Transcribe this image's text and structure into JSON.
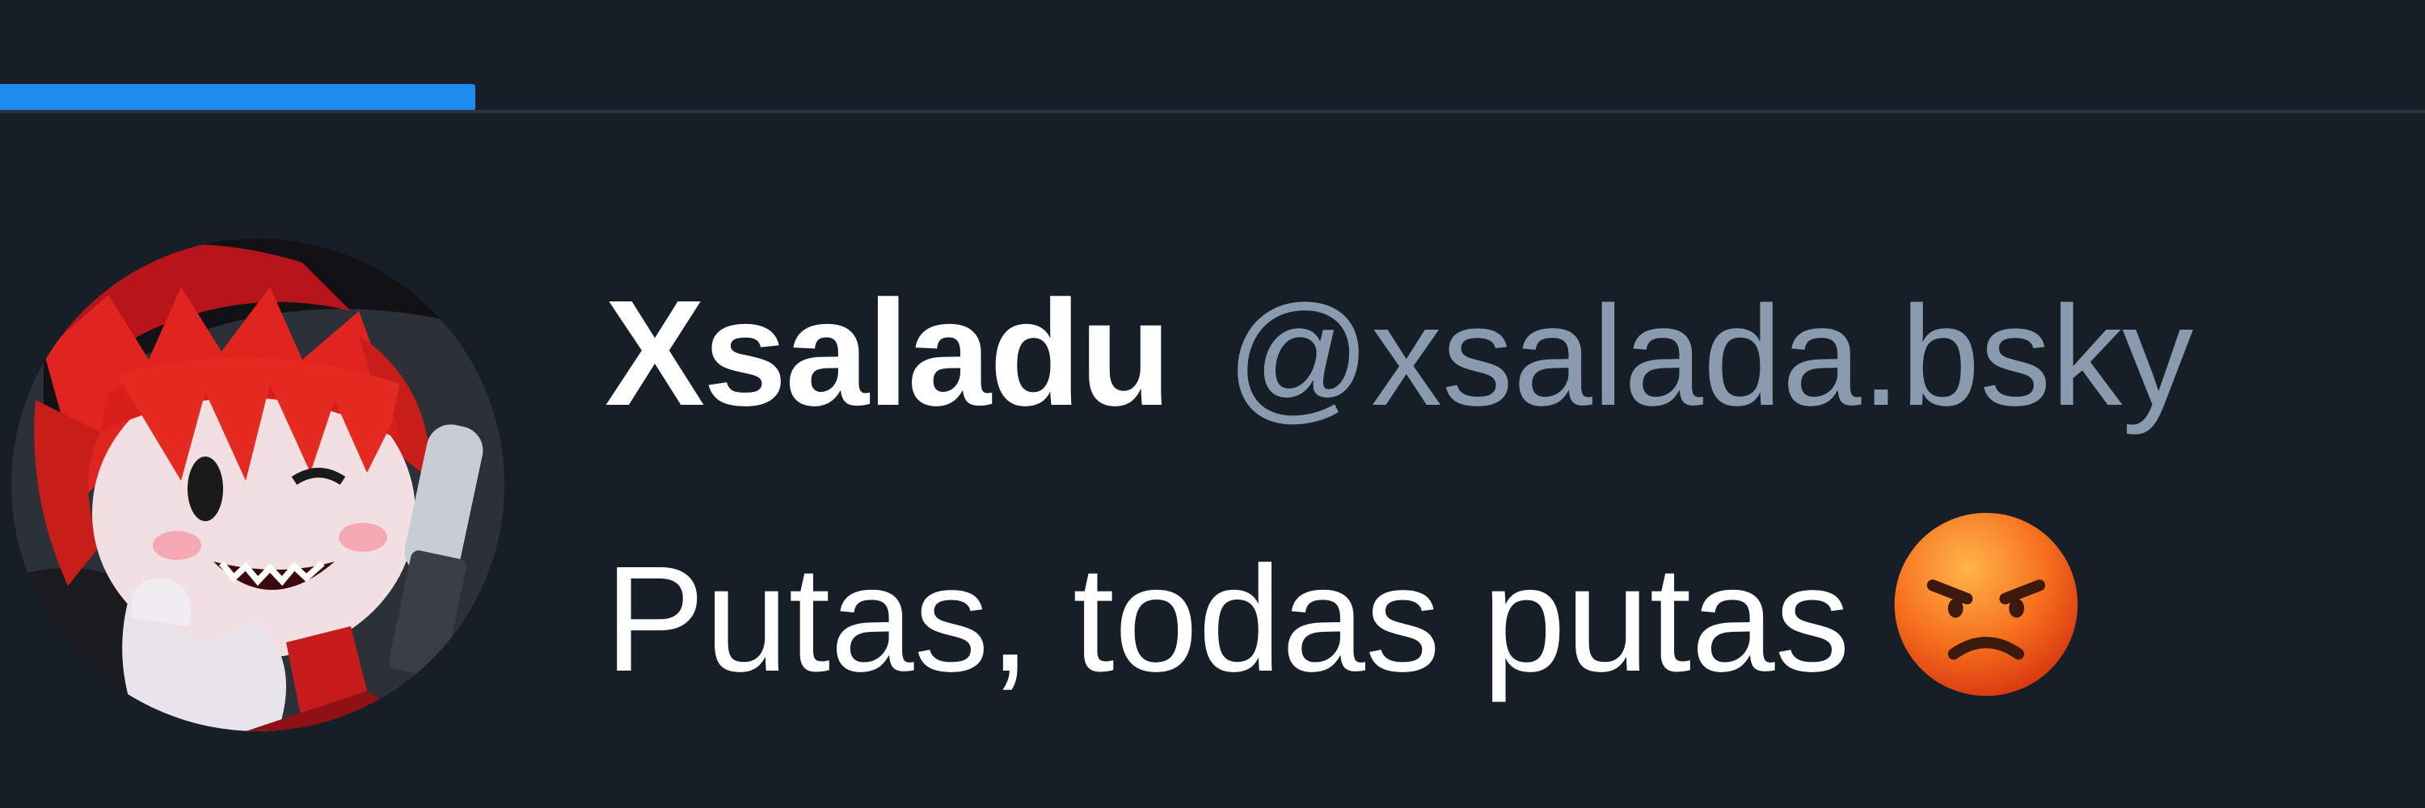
{
  "header": {
    "active_tab_color": "#1d8bf0"
  },
  "post": {
    "author": {
      "display_name": "Xsaladu",
      "handle": "@xsalada.bsky",
      "avatar_icon": "anime-avatar"
    },
    "text": "Putas, todas putas",
    "emoji": {
      "name": "angry-face-emoji",
      "char": "😠"
    }
  },
  "colors": {
    "background": "#161e27",
    "display_name": "#ffffff",
    "handle": "#8a9bb0",
    "text": "#ffffff",
    "accent": "#1d8bf0"
  }
}
